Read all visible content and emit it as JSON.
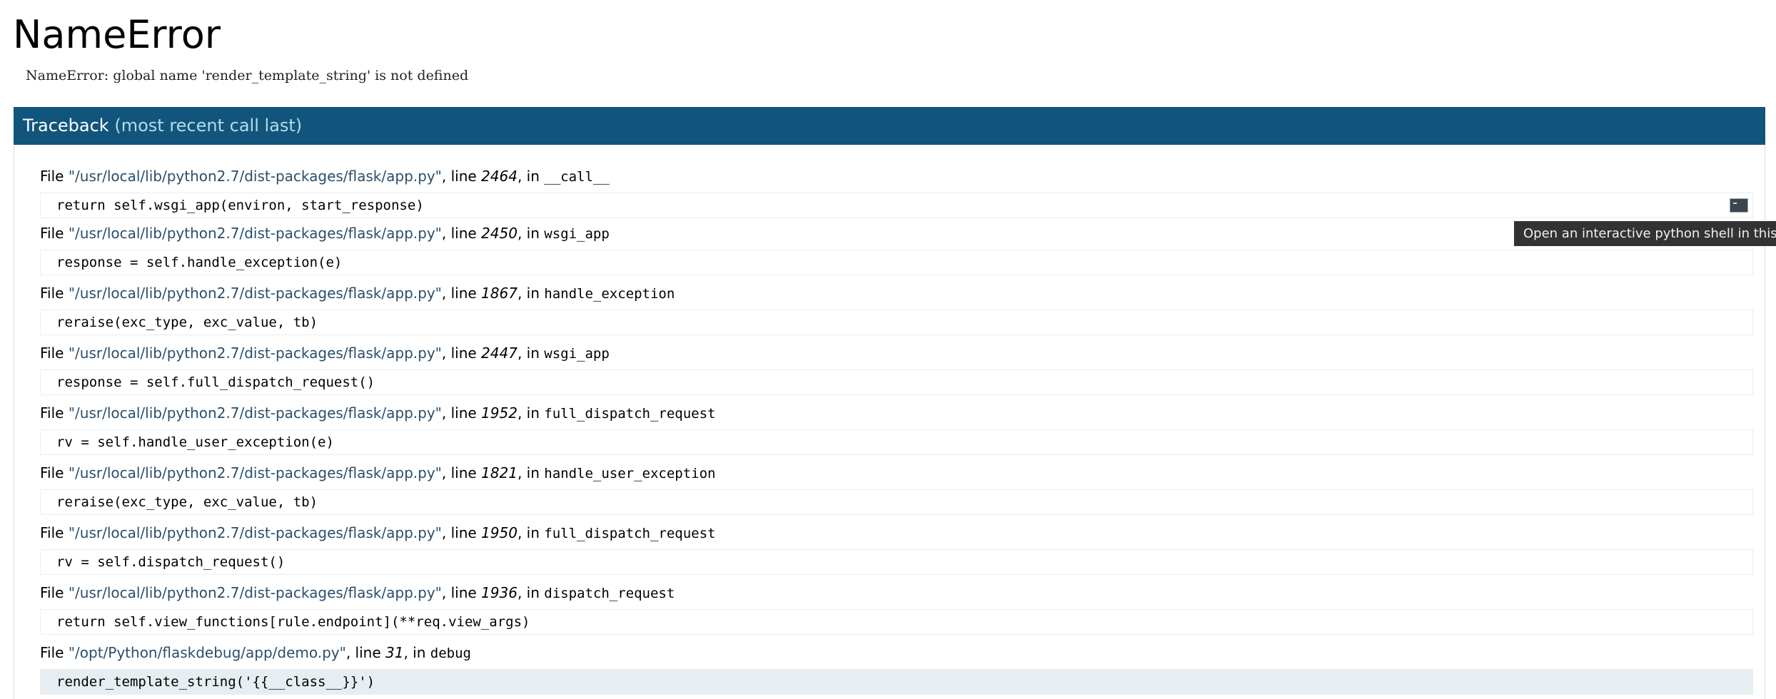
{
  "page": {
    "title": "NameError",
    "error_message": "NameError: global name 'render_template_string' is not defined"
  },
  "traceback": {
    "header_label": "Traceback",
    "header_sub": "(most recent call last)",
    "file_prefix": "File ",
    "line_prefix": ", line ",
    "in_prefix": ", in ",
    "frames": [
      {
        "path": "\"/usr/local/lib/python2.7/dist-packages/flask/app.py\"",
        "line": "2464",
        "func": "__call__",
        "code": "return self.wsgi_app(environ, start_response)"
      },
      {
        "path": "\"/usr/local/lib/python2.7/dist-packages/flask/app.py\"",
        "line": "2450",
        "func": "wsgi_app",
        "code": "response = self.handle_exception(e)"
      },
      {
        "path": "\"/usr/local/lib/python2.7/dist-packages/flask/app.py\"",
        "line": "1867",
        "func": "handle_exception",
        "code": "reraise(exc_type, exc_value, tb)"
      },
      {
        "path": "\"/usr/local/lib/python2.7/dist-packages/flask/app.py\"",
        "line": "2447",
        "func": "wsgi_app",
        "code": "response = self.full_dispatch_request()"
      },
      {
        "path": "\"/usr/local/lib/python2.7/dist-packages/flask/app.py\"",
        "line": "1952",
        "func": "full_dispatch_request",
        "code": "rv = self.handle_user_exception(e)"
      },
      {
        "path": "\"/usr/local/lib/python2.7/dist-packages/flask/app.py\"",
        "line": "1821",
        "func": "handle_user_exception",
        "code": "reraise(exc_type, exc_value, tb)"
      },
      {
        "path": "\"/usr/local/lib/python2.7/dist-packages/flask/app.py\"",
        "line": "1950",
        "func": "full_dispatch_request",
        "code": "rv = self.dispatch_request()"
      },
      {
        "path": "\"/usr/local/lib/python2.7/dist-packages/flask/app.py\"",
        "line": "1936",
        "func": "dispatch_request",
        "code": "return self.view_functions[rule.endpoint](**req.view_args)"
      },
      {
        "path": "\"/opt/Python/flaskdebug/app/demo.py\"",
        "line": "31",
        "func": "debug",
        "code": "render_template_string('{{__class__}}')"
      }
    ]
  },
  "console": {
    "icon": "console-icon",
    "tooltip": "Open an interactive python shell in this frame"
  },
  "colors": {
    "header_bg": "#11557c",
    "header_sub": "#b5dbe8",
    "path": "#2a4e6c",
    "current_frame_bg": "#e6eef2",
    "tooltip_bg": "#333333"
  }
}
